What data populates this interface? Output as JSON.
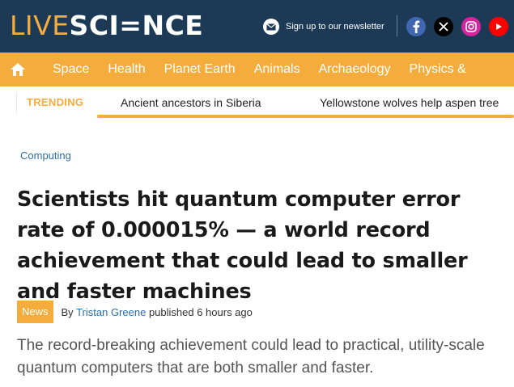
{
  "header": {
    "logo_live": "LIVE",
    "logo_science": "SCI=NCE",
    "newsletter": "Sign up to our newsletter",
    "social": [
      "facebook-icon",
      "x-icon",
      "instagram-icon",
      "youtube-icon"
    ],
    "colors": {
      "header_bg": "#1c3a55",
      "accent": "#f4ad3d"
    }
  },
  "nav": {
    "items": [
      "Space",
      "Health",
      "Planet Earth",
      "Animals",
      "Archaeology",
      "Physics &"
    ]
  },
  "trending": {
    "label": "TRENDING",
    "items": [
      "Ancient ancestors in Siberia",
      "Yellowstone wolves help aspen tree"
    ]
  },
  "article": {
    "category": "Computing",
    "headline": "Scientists hit quantum computer error rate of 0.000015% — a world record achievement that could lead to smaller and faster machines",
    "badge": "News",
    "by": "By",
    "author": "Tristan Greene",
    "published": "published 6 hours ago",
    "subtitle": "The record-breaking achievement could lead to practical, utility-scale quantum computers that are both smaller and faster."
  }
}
